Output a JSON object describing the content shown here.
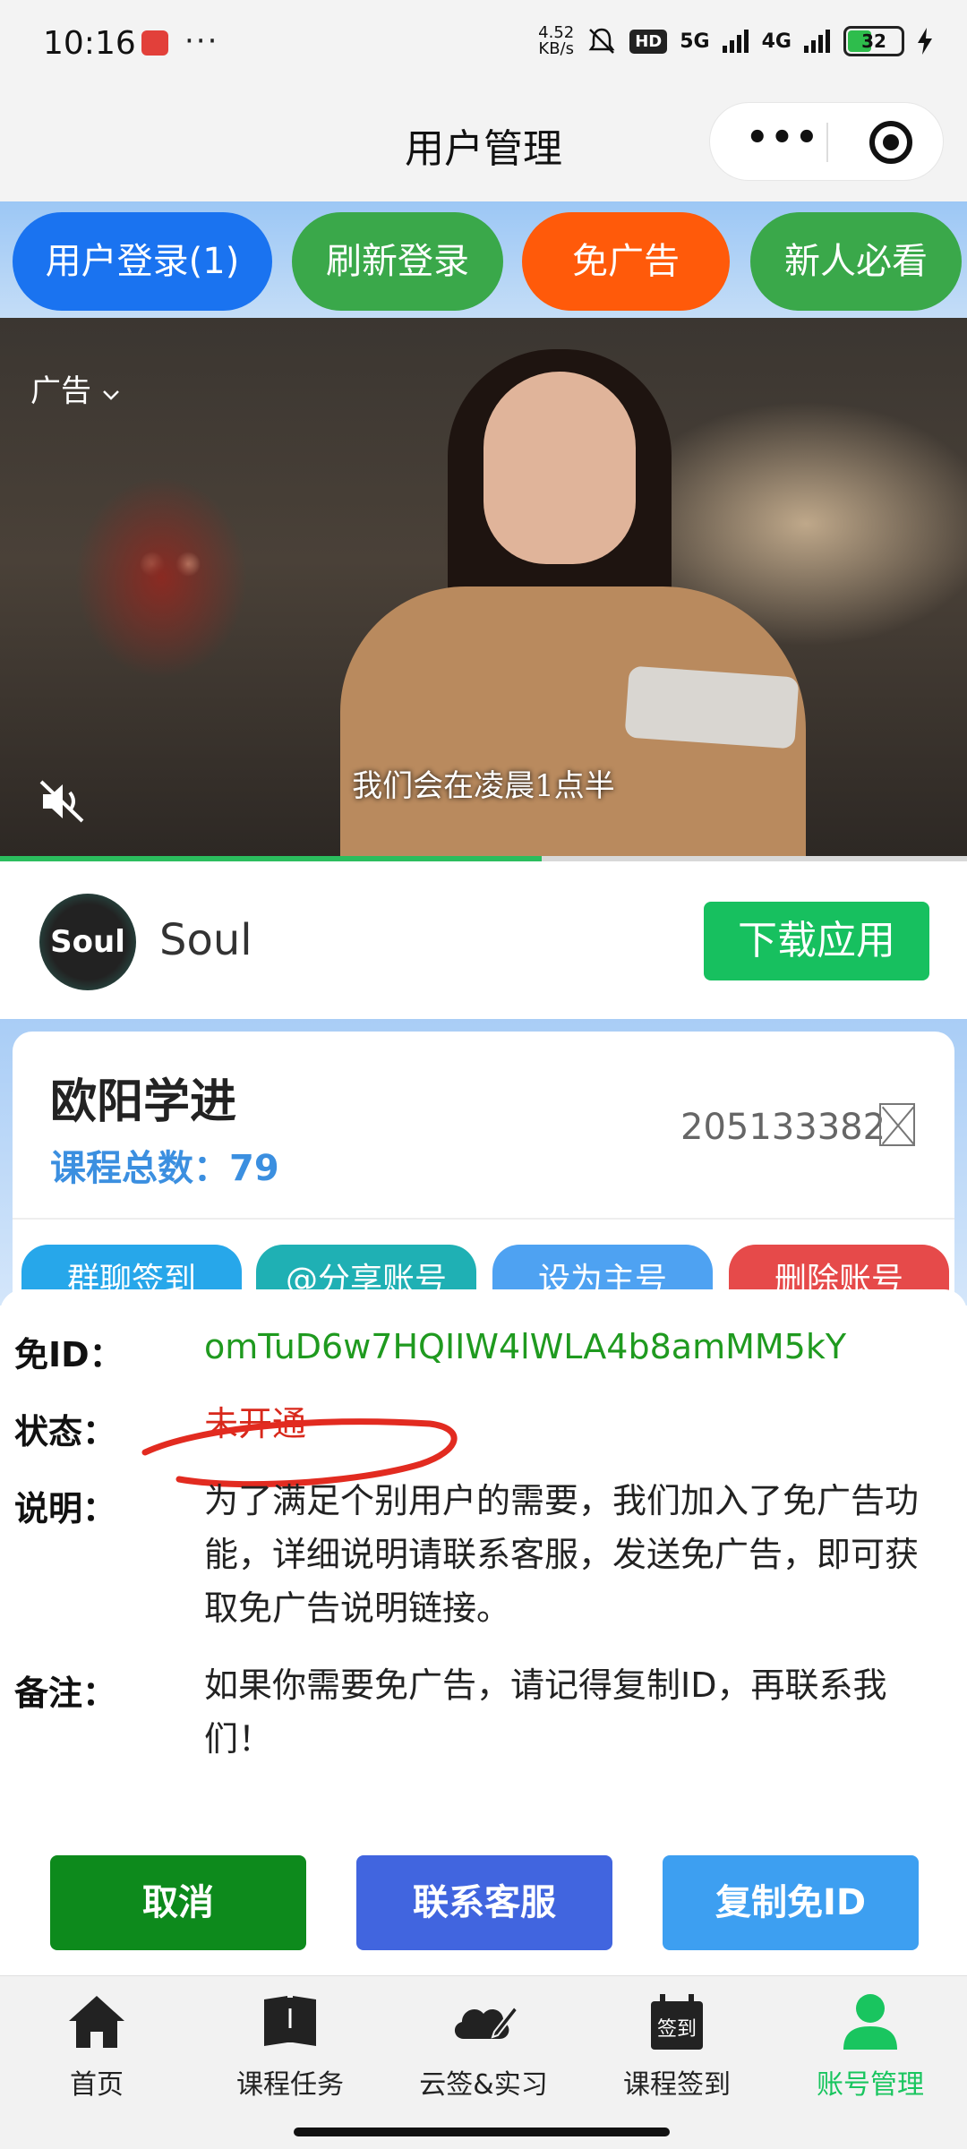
{
  "status_bar": {
    "time": "10:16",
    "more": "···",
    "net_speed_value": "4.52",
    "net_speed_unit": "KB/s",
    "hd": "HD",
    "signal1": "5G",
    "signal2": "4G",
    "battery": "32"
  },
  "title_bar": {
    "title": "用户管理",
    "more": "•••"
  },
  "top_buttons": {
    "login": "用户登录(1)",
    "refresh": "刷新登录",
    "no_ads": "免广告",
    "guide": "新人必看"
  },
  "ad": {
    "label": "广告",
    "subtitle": "我们会在凌晨1点半",
    "progress_percent": 56,
    "app_logo_text": "Soul",
    "app_name": "Soul",
    "download_label": "下载应用"
  },
  "user_card": {
    "name": "欧阳学进",
    "course_total_label": "课程总数：",
    "course_total_value": "79",
    "user_id": "205133382",
    "actions": [
      "群聊签到",
      "@分享账号",
      "设为主号",
      "删除账号"
    ]
  },
  "dialog": {
    "free_id_label": "免ID：",
    "free_id_value": "omTuD6w7HQIIW4lWLA4b8amMM5kY",
    "status_label": "状态：",
    "status_value": "未开通",
    "desc_label": "说明：",
    "desc_value": "为了满足个别用户的需要，我们加入了免广告功能，详细说明请联系客服，发送免广告，即可获取免广告说明链接。",
    "note_label": "备注：",
    "note_value": "如果你需要免广告，请记得复制ID，再联系我们！",
    "cancel": "取消",
    "contact": "联系客服",
    "copy_id": "复制免ID"
  },
  "tabs": [
    {
      "label": "首页",
      "icon": "home-icon"
    },
    {
      "label": "课程任务",
      "icon": "book-icon"
    },
    {
      "label": "云签&实习",
      "icon": "cloud-sign-icon"
    },
    {
      "label": "课程签到",
      "icon": "calendar-sign-icon",
      "icon_text": "签到"
    },
    {
      "label": "账号管理",
      "icon": "user-icon",
      "active": true
    }
  ],
  "colors": {
    "accent_green": "#19c55f",
    "brand_blue": "#1a73f0",
    "alert_red": "#d8281b"
  }
}
